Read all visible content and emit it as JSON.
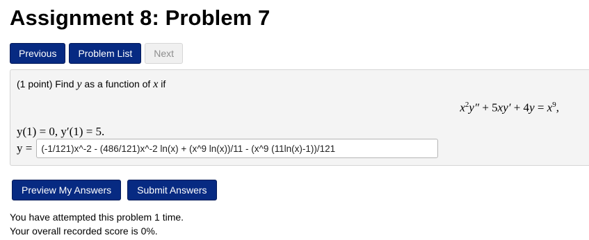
{
  "page": {
    "title": "Assignment 8: Problem 7"
  },
  "nav": {
    "previous_label": "Previous",
    "problem_list_label": "Problem List",
    "next_label": "Next"
  },
  "problem": {
    "points": "(1 point) Find",
    "var_y": "y",
    "as_function_of": "as a function of",
    "var_x": "x",
    "if_word": "if",
    "equation_parts": {
      "x": "x",
      "sq": "2",
      "ypp": "y″",
      "plus1": " + 5",
      "xy": "xy′",
      "plus2": " + 4",
      "y": "y",
      "eq": " = ",
      "x2": "x",
      "nine": "9",
      "comma": ","
    },
    "initial_conditions": "y(1) = 0,  y′(1) = 5.",
    "answer_label": "y =",
    "answer_value": "(-1/121)x^-2 - (486/121)x^-2 ln(x) + (x^9 ln(x))/11 - (x^9 (11ln(x)-1))/121"
  },
  "actions": {
    "preview_label": "Preview My Answers",
    "submit_label": "Submit Answers"
  },
  "status": {
    "attempts": "You have attempted this problem 1 time.",
    "score": "Your overall recorded score is 0%."
  },
  "colors": {
    "primary_button": "#072a82",
    "disabled_button": "#f0f0f0",
    "problem_background": "#f4f4f4"
  }
}
